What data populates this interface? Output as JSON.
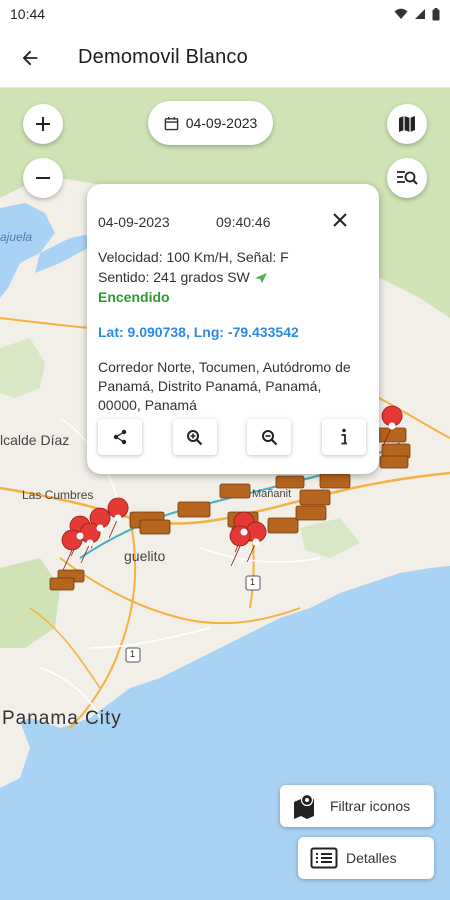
{
  "status_bar": {
    "time": "10:44"
  },
  "app_bar": {
    "title": "Demomovil Blanco"
  },
  "date_chip": {
    "date": "04-09-2023"
  },
  "map_labels": {
    "jajuela": "ajuela",
    "alcalde_diaz": "lcalde Díaz",
    "las_cumbres": "Las Cumbres",
    "miguelito": "guelito",
    "mananitas": "Mañanit",
    "panama_city": "Panama City",
    "route_1a": "1",
    "route_1b": "1"
  },
  "popup": {
    "date": "04-09-2023",
    "time": "09:40:46",
    "speed_signal": "Velocidad: 100 Km/H, Señal: F",
    "direction": " Sentido: 241 grados SW",
    "status": "Encendido",
    "coords": "Lat: 9.090738, Lng: -79.433542",
    "address": "Corredor Norte, Tocumen, Autódromo de Panamá, Distrito Panamá, Panamá, 00000, Panamá"
  },
  "buttons": {
    "filter_icons": "Filtrar iconos",
    "details": "Detalles"
  },
  "icons": {
    "back": "arrow-left-icon",
    "zoom_in": "plus-icon",
    "zoom_out": "minus-icon",
    "calendar": "calendar-icon",
    "map_type": "map-icon",
    "search_list": "search-list-icon",
    "close": "close-icon",
    "share": "share-icon",
    "zoom_plus": "zoom-in-icon",
    "zoom_minus": "zoom-out-icon",
    "info": "info-icon",
    "filter": "map-marker-icon",
    "details": "list-icon"
  },
  "colors": {
    "water": "#a9d3f5",
    "land": "#f2efe9",
    "green": "#cfe3b4",
    "road": "#f5b041",
    "status_on": "#2e9b2e",
    "coords": "#2a8be0",
    "marker": "#e53935"
  }
}
